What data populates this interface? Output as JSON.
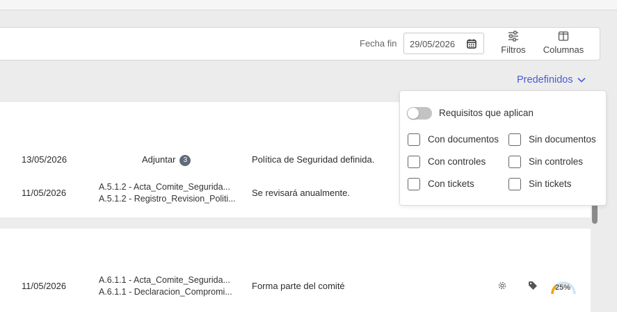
{
  "filter": {
    "fecha_fin_label": "Fecha fin",
    "fecha_fin_value": "29/05/2026",
    "filtros_label": "Filtros",
    "columnas_label": "Columnas"
  },
  "predefinidos": {
    "label": "Predefinidos"
  },
  "dropdown": {
    "toggle_label": "Requisitos que aplican",
    "toggle_on": false,
    "options": [
      {
        "label": "Con documentos",
        "checked": false
      },
      {
        "label": "Sin documentos",
        "checked": false
      },
      {
        "label": "Con controles",
        "checked": false
      },
      {
        "label": "Sin controles",
        "checked": false
      },
      {
        "label": "Con tickets",
        "checked": false
      },
      {
        "label": "Sin tickets",
        "checked": false
      }
    ]
  },
  "rows": [
    {
      "date": "13/05/2026",
      "attach_label": "Adjuntar",
      "attach_count": "3",
      "comment": "Política de Seguridad definida."
    },
    {
      "date": "11/05/2026",
      "doc1": "A.5.1.2 - Acta_Comite_Segurida...",
      "doc2": "A.5.1.2 - Registro_Revision_Politi...",
      "comment": "Se revisará anualmente."
    },
    {
      "date": "11/05/2026",
      "doc1": "A.6.1.1 - Acta_Comite_Segurida...",
      "doc2": "A.6.1.1 - Declaracion_Compromi...",
      "comment": "Forma parte del comité",
      "progress_text": "25%",
      "progress": 0.25
    }
  ],
  "icons": {
    "calendar": "calendar-icon",
    "filters": "sliders-icon",
    "columns": "columns-icon",
    "chevron": "chevron-down-icon",
    "gear": "gear-icon",
    "tag": "tag-icon"
  },
  "colors": {
    "accent": "#4a5bd6",
    "progress": "#f0a500",
    "progress_track": "#cfe3f5"
  }
}
